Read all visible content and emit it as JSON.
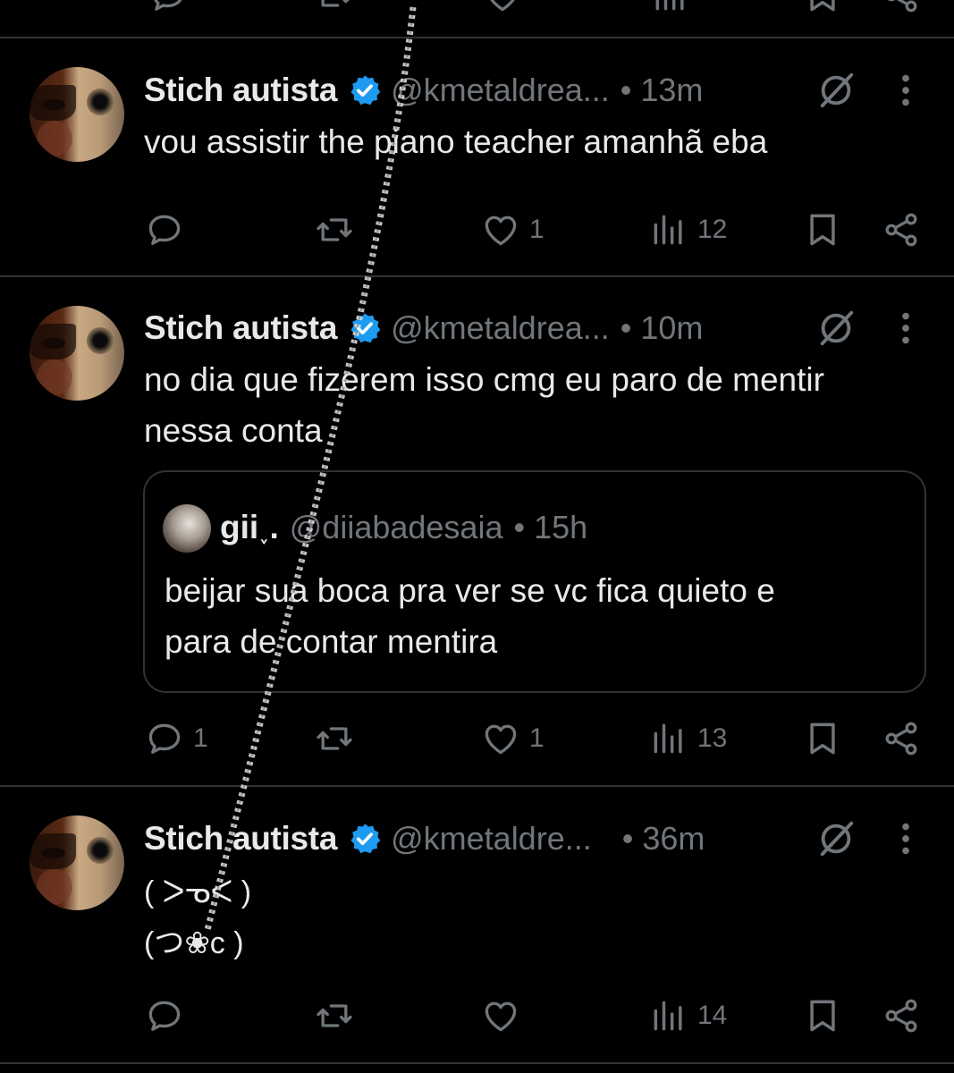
{
  "tweets": [
    {
      "author": "Stich autista",
      "handle": "@kmetaldrea...",
      "separator": "•",
      "time": "13m",
      "text": "vou assistir the piano teacher amanhã eba",
      "stats": {
        "replies": "",
        "reposts": "",
        "likes": "1",
        "views": "12"
      }
    },
    {
      "author": "Stich autista",
      "handle": "@kmetaldrea...",
      "separator": "•",
      "time": "10m",
      "text": "no dia que fizerem isso cmg eu paro de mentir\nnessa conta",
      "quote": {
        "author": "gii˯.",
        "handle": "@diiabadesaia",
        "separator": "•",
        "time": "15h",
        "text": "beijar sua boca pra ver se vc fica quieto e\npara de contar mentira"
      },
      "stats": {
        "replies": "1",
        "reposts": "",
        "likes": "1",
        "views": "13"
      }
    },
    {
      "author": "Stich autista",
      "handle": "@kmetaldre...",
      "separator": "•",
      "time": "36m",
      "text": "( ᐳᓀᐸ )\n(つ⁠❀c )",
      "stats": {
        "replies": "",
        "reposts": "",
        "likes": "",
        "views": "14"
      }
    }
  ],
  "colors": {
    "background": "#000000",
    "text": "#e7e9ea",
    "secondary": "#71767b",
    "divider": "#2f3336",
    "verified": "#1d9bf0"
  },
  "icons": [
    "reply-icon",
    "repost-icon",
    "like-icon",
    "views-icon",
    "bookmark-icon",
    "share-icon",
    "grok-icon",
    "more-icon",
    "verified-badge-icon"
  ]
}
